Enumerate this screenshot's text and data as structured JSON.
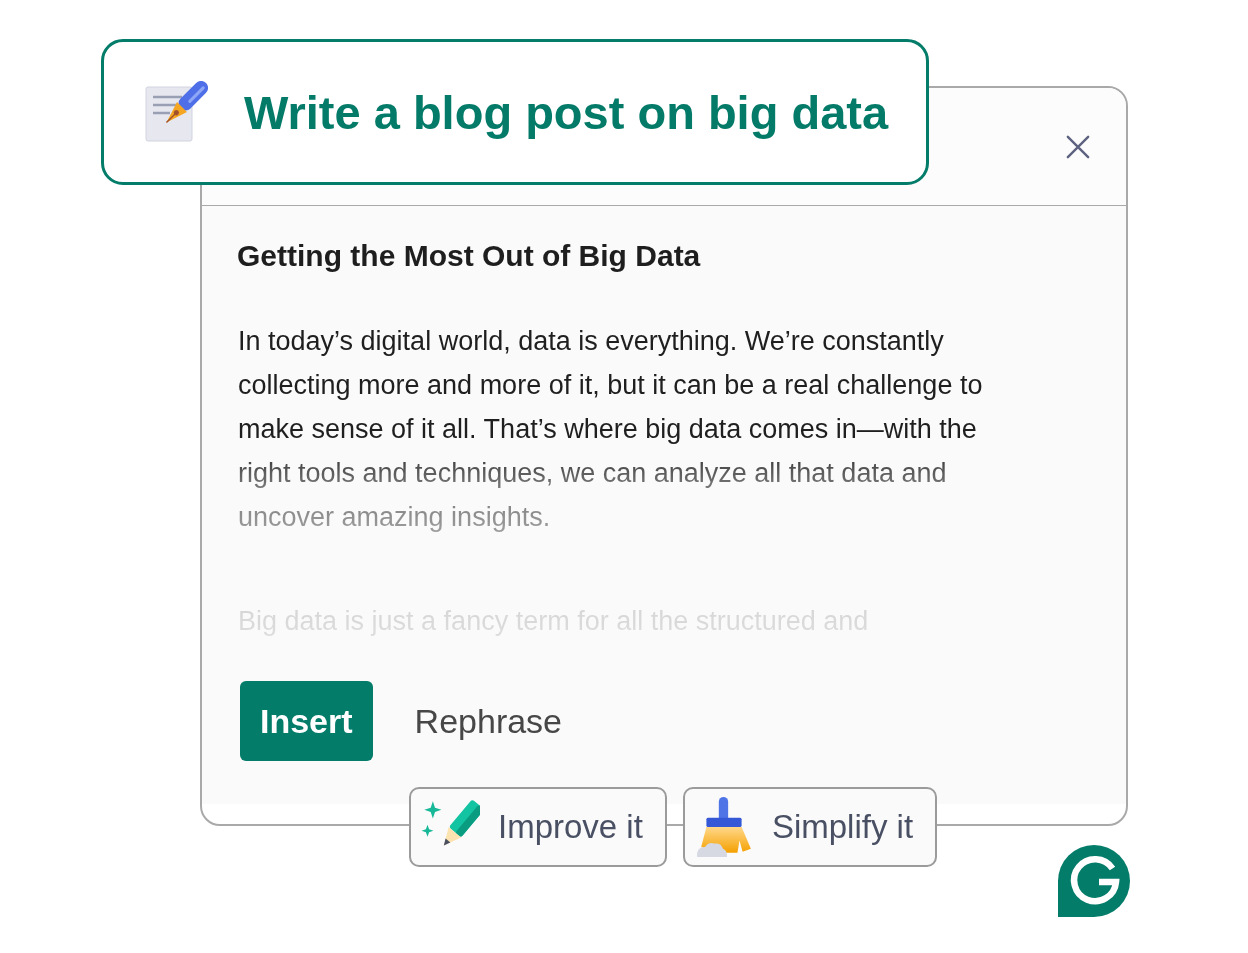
{
  "prompt": {
    "text": "Write a blog post on big data"
  },
  "draft": {
    "title": "Getting the Most Out of Big Data",
    "paragraphs": [
      "In today’s digital world, data is everything. We’re constantly collecting more and more of it, but it can be a real challenge to make sense of it all. That’s where big data comes in—with the right tools and techniques, we can analyze all that data and uncover amazing insights.",
      "Big data is just a fancy term for all the structured and"
    ]
  },
  "actions": [
    {
      "label": "Insert",
      "kind": "primary"
    },
    {
      "label": "Rephrase",
      "kind": "text"
    }
  ],
  "suggestions": [
    {
      "label": "Improve it",
      "kind": "improve"
    },
    {
      "label": "Simplify it",
      "kind": "simplify"
    }
  ]
}
